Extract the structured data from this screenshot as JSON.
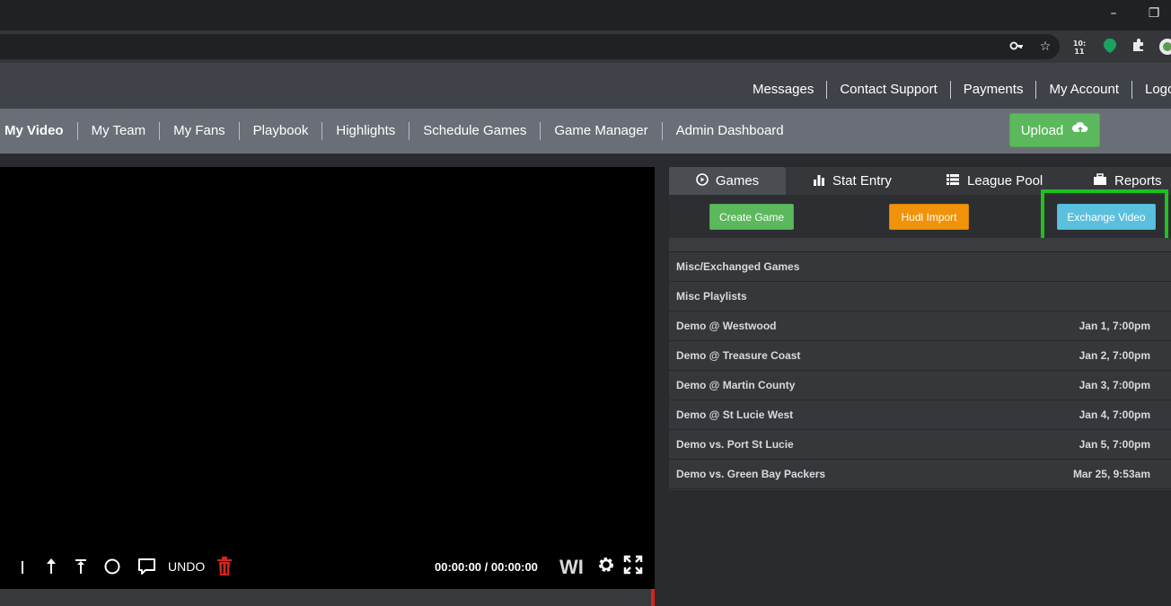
{
  "browser": {
    "window_controls": {
      "minimize": "–",
      "restore": "❐"
    },
    "toolbar_icons": [
      "key-icon",
      "star-icon",
      "timer-extension-icon",
      "green-extension-icon",
      "puzzle-icon",
      "profile-icon"
    ],
    "timer_text": "10:\n11"
  },
  "topnav": {
    "links": [
      "Messages",
      "Contact Support",
      "Payments",
      "My Account",
      "Logo"
    ]
  },
  "mainnav": {
    "links": [
      "My Video",
      "My Team",
      "My Fans",
      "Playbook",
      "Highlights",
      "Schedule Games",
      "Game Manager",
      "Admin Dashboard"
    ],
    "upload_label": "Upload"
  },
  "video": {
    "tools": [
      "line-tool-icon",
      "arrow-tool-icon",
      "t-arrow-tool-icon",
      "circle-tool-icon",
      "comment-tool-icon"
    ],
    "undo_label": "UNDO",
    "time": "00:00:00 / 00:00:00",
    "wi_label": "WI"
  },
  "panel": {
    "tabs": [
      "Games",
      "Stat Entry",
      "League Pool",
      "Reports"
    ],
    "actions": {
      "create_game": "Create Game",
      "hudl_import": "Hudl Import",
      "exchange_video": "Exchange Video"
    },
    "games": [
      {
        "name": "Misc/Exchanged Games",
        "date": ""
      },
      {
        "name": "Misc Playlists",
        "date": ""
      },
      {
        "name": "Demo @ Westwood",
        "date": "Jan 1, 7:00pm"
      },
      {
        "name": "Demo @ Treasure Coast",
        "date": "Jan 2, 7:00pm"
      },
      {
        "name": "Demo @ Martin County",
        "date": "Jan 3, 7:00pm"
      },
      {
        "name": "Demo @ St Lucie West",
        "date": "Jan 4, 7:00pm"
      },
      {
        "name": "Demo vs. Port St Lucie",
        "date": "Jan 5, 7:00pm"
      },
      {
        "name": "Demo vs. Green Bay Packers",
        "date": "Mar 25, 9:53am"
      }
    ]
  },
  "colors": {
    "upload_green": "#5cb85c",
    "create_green": "#5cb85c",
    "hudl_orange": "#f0920a",
    "exchange_blue": "#5bc0de",
    "highlight_green": "#20c020",
    "trash_red": "#d9221c"
  }
}
